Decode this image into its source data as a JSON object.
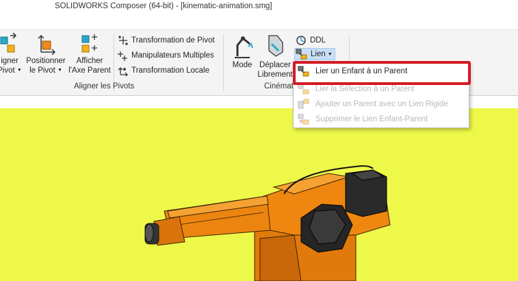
{
  "window": {
    "title": "SOLIDWORKS Composer (64-bit) - [kinematic-animation.smg]"
  },
  "ribbon": {
    "align_pivots": {
      "label": "Aligner les Pivots",
      "align_btn": {
        "line1": "igner",
        "line2": "Pivot"
      },
      "position_btn": {
        "line1": "Positionner",
        "line2": "le Pivot"
      },
      "show_axis_btn": {
        "line1": "Afficher",
        "line2": "l'Axe Parent"
      },
      "pivot_transform": "Transformation de Pivot",
      "multi_manipulators": "Manipulateurs Multiples",
      "local_transform": "Transformation Locale"
    },
    "kinematics": {
      "label": "Cinémati",
      "mode_btn": "Mode",
      "move_free_btn": {
        "line1": "Déplacer",
        "line2": "Librement"
      },
      "ddl_btn": "DDL",
      "lien_btn": "Lien"
    }
  },
  "lien_menu": {
    "items": [
      {
        "label": "Lier un Enfant à un Parent",
        "enabled": true
      },
      {
        "label": "Lier la Sélection à un Parent",
        "enabled": false
      },
      {
        "label": "Ajouter un Parent avec un Lien Rigide",
        "enabled": false
      },
      {
        "label": "Supprimer le Lien Enfant-Parent",
        "enabled": false
      }
    ]
  },
  "colors": {
    "viewport_bg": "#eef848",
    "robot_orange": "#e8800e",
    "highlight_red": "#d21a22"
  }
}
